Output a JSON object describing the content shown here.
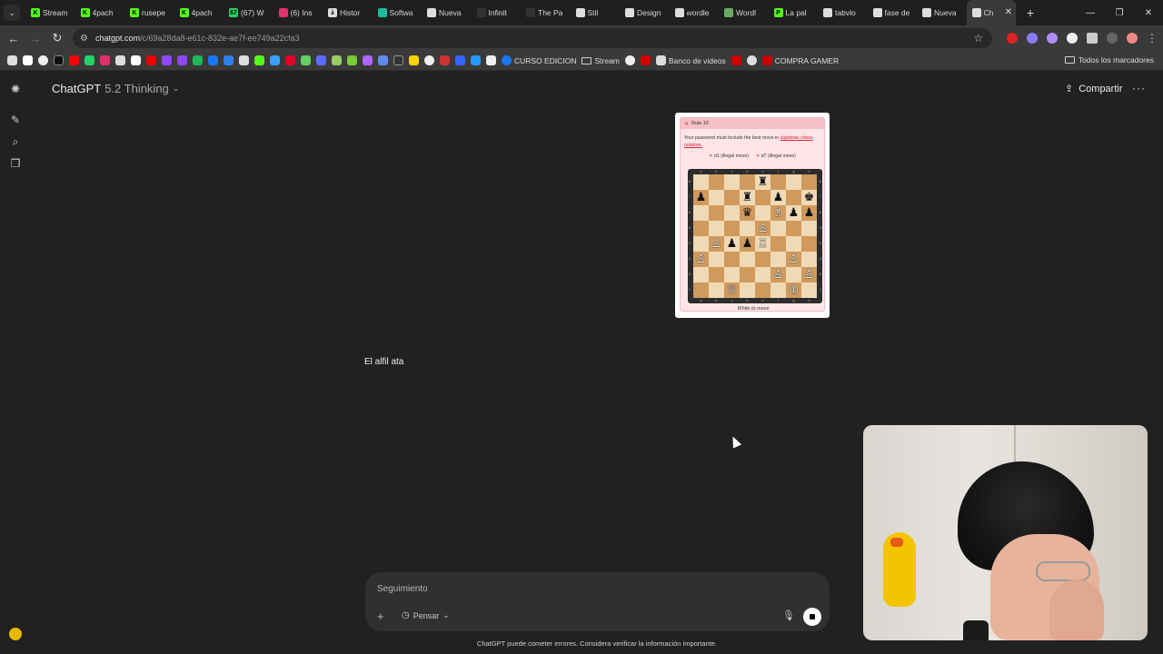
{
  "browser": {
    "tabs": [
      {
        "label": "Stream",
        "favicon_color": "#53fc18",
        "favicon_text": "K"
      },
      {
        "label": "4pach",
        "favicon_color": "#53fc18",
        "favicon_text": "K"
      },
      {
        "label": "rusepe",
        "favicon_color": "#53fc18",
        "favicon_text": "K"
      },
      {
        "label": "4pach",
        "favicon_color": "#53fc18",
        "favicon_text": "K"
      },
      {
        "label": "(67) W",
        "favicon_color": "#25d366",
        "favicon_text": "67"
      },
      {
        "label": "(6) Ins",
        "favicon_color": "#e1306c",
        "favicon_text": ""
      },
      {
        "label": "Histor",
        "favicon_color": "#dddddd",
        "favicon_text": "⤓"
      },
      {
        "label": "Softwa",
        "favicon_color": "#1abc9c",
        "favicon_text": ""
      },
      {
        "label": "Nueva",
        "favicon_color": "#dddddd",
        "favicon_text": ""
      },
      {
        "label": "Infinit",
        "favicon_color": "#333333",
        "favicon_text": ""
      },
      {
        "label": "The Pa",
        "favicon_color": "#333333",
        "favicon_text": ""
      },
      {
        "label": "Stil",
        "favicon_color": "#dddddd",
        "favicon_text": ""
      },
      {
        "label": "Design",
        "favicon_color": "#dddddd",
        "favicon_text": ""
      },
      {
        "label": "wordle",
        "favicon_color": "#dddddd",
        "favicon_text": ""
      },
      {
        "label": "Wordl",
        "favicon_color": "#6aaa64",
        "favicon_text": ""
      },
      {
        "label": "La pal",
        "favicon_color": "#53fc18",
        "favicon_text": "P"
      },
      {
        "label": "tabvlo",
        "favicon_color": "#dddddd",
        "favicon_text": ""
      },
      {
        "label": "fase de",
        "favicon_color": "#dddddd",
        "favicon_text": ""
      },
      {
        "label": "Nueva",
        "favicon_color": "#dddddd",
        "favicon_text": ""
      },
      {
        "label": "Ch",
        "favicon_color": "#dddddd",
        "favicon_text": "",
        "active": true
      }
    ],
    "url_host": "chatgpt.com",
    "url_path": "/c/69a28da8-e61c-832e-ae7f-ee749a22cfa3",
    "bookmarks": {
      "curso_edicion": "CURSO EDICION",
      "stream": "Stream",
      "banco_videos": "Banco de videos",
      "compra_gamer": "COMPRA GAMER",
      "all_bookmarks": "Todos los marcadores"
    }
  },
  "header": {
    "model_name": "ChatGPT",
    "model_version": "5.2 Thinking",
    "share_label": "Compartir"
  },
  "attachment": {
    "rule_title": "Rule 16",
    "rule_text": "Your password must include the best move in",
    "rule_link": "algebraic chess notation.",
    "tries": [
      "d1 (illegal move)",
      "d7 (illegal move)"
    ],
    "caption": "White to move",
    "board": [
      [
        "",
        "",
        "",
        "",
        "♜",
        "",
        "",
        ""
      ],
      [
        "♟",
        "",
        "",
        "♜",
        "",
        "♟",
        "",
        "♚"
      ],
      [
        "",
        "",
        "",
        "♛",
        "",
        "♗",
        "♟",
        "♟"
      ],
      [
        "",
        "",
        "",
        "",
        "♙",
        "",
        "",
        ""
      ],
      [
        "",
        "♙",
        "♟",
        "♟",
        "♖",
        "",
        "",
        ""
      ],
      [
        "♙",
        "",
        "",
        "",
        "",
        "",
        "♙",
        ""
      ],
      [
        "",
        "",
        "",
        "",
        "",
        "♙",
        "",
        "♙"
      ],
      [
        "",
        "",
        "♕",
        "",
        "",
        "",
        "♔",
        ""
      ]
    ],
    "files": [
      "a",
      "b",
      "c",
      "d",
      "e",
      "f",
      "g",
      "h"
    ],
    "ranks": [
      "8",
      "7",
      "6",
      "5",
      "4",
      "3",
      "2",
      "1"
    ]
  },
  "conversation": {
    "assistant_message": "El alfil ata"
  },
  "composer": {
    "placeholder": "Seguimiento",
    "think_label": "Pensar"
  },
  "footer": {
    "disclaimer": "ChatGPT puede cometer errores. Considera verificar la información importante."
  }
}
